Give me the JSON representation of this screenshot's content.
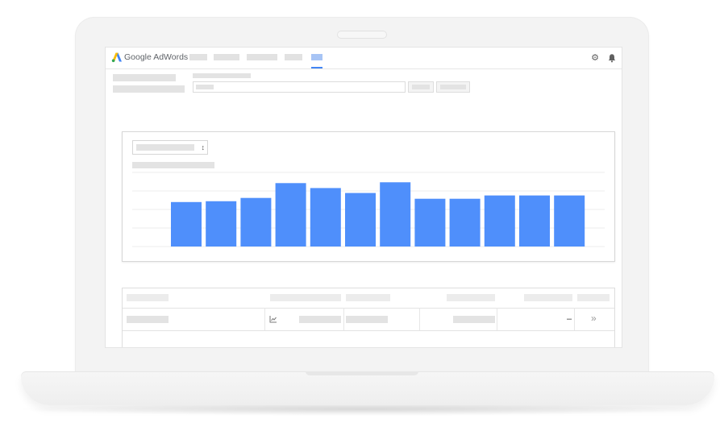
{
  "app": {
    "brand_name": "Google AdWords",
    "accent_color": "#4285f4",
    "logo_icon": "adwords-logo-icon"
  },
  "toolbar": {
    "settings_icon": "gear-icon",
    "notifications_icon": "bell-icon"
  },
  "chart_data": {
    "type": "bar",
    "series": [
      {
        "values": [
          54,
          55,
          59,
          77,
          71,
          65,
          78,
          58,
          58,
          62,
          62,
          62
        ]
      }
    ],
    "grid": true,
    "bar_color": "#4f8ffb"
  },
  "table": {
    "row_status_icon": "chart-line-icon",
    "row_dash": "–",
    "row_action": "»",
    "row_action_icon": "double-chevron-right-icon"
  }
}
